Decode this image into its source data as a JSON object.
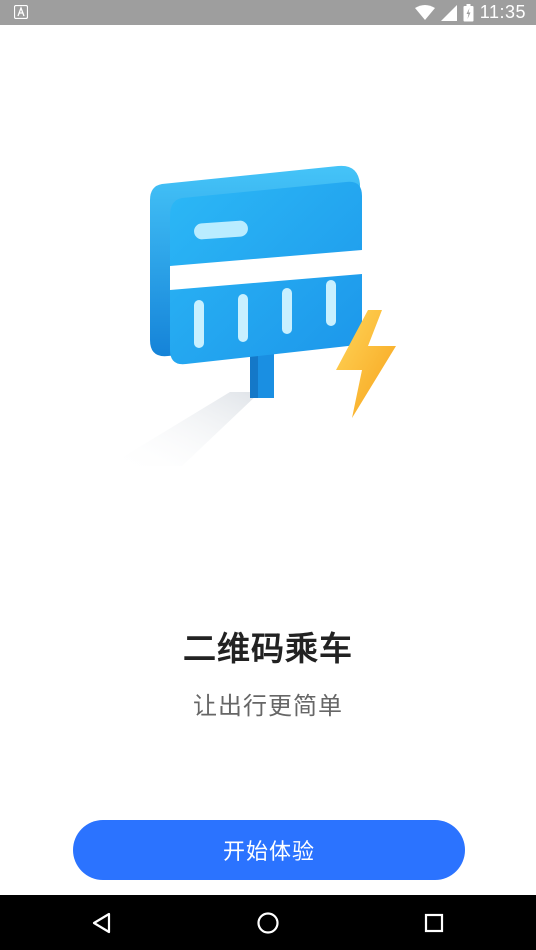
{
  "status_bar": {
    "time": "11:35",
    "icons": [
      "app-notification-icon",
      "wifi-icon",
      "signal-icon",
      "battery-icon"
    ],
    "background": "#9e9e9e"
  },
  "onboarding": {
    "illustration": "card-reader-lightning-illustration",
    "title": "二维码乘车",
    "subtitle": "让出行更简单",
    "start_button_label": "开始体验",
    "accent_color": "#2b73ff"
  },
  "nav_bar": {
    "buttons": [
      "back-icon",
      "home-icon",
      "recents-icon"
    ]
  }
}
